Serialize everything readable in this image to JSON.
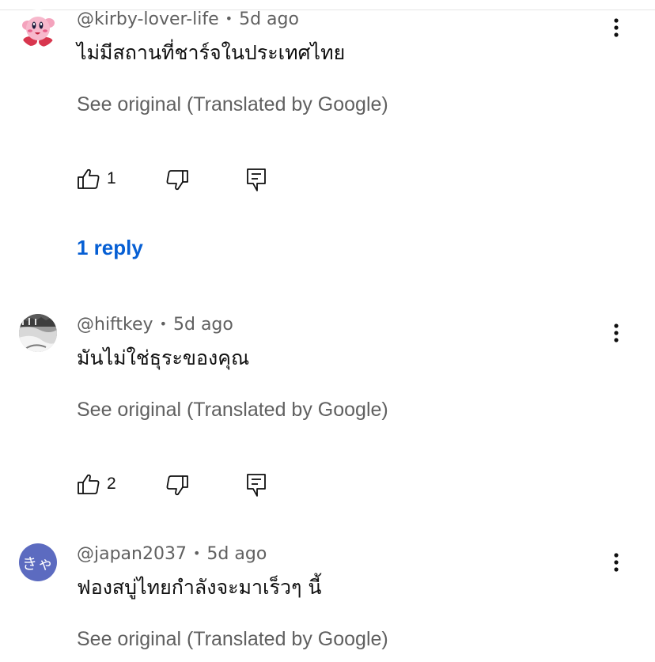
{
  "comments": [
    {
      "author": "@kirby-lover-life",
      "time": "5d ago",
      "text": "ไม่มีสถานที่ชาร์จในประเทศไทย",
      "see_original": "See original (Translated by Google)",
      "likes": "1",
      "replies_label": "1 reply",
      "avatar": "kirby-avatar"
    },
    {
      "author": "@hiftkey",
      "time": "5d ago",
      "text": "มันไม่ใช่ธุระของคุณ",
      "see_original": "See original (Translated by Google)",
      "likes": "2",
      "avatar": "photo-avatar"
    },
    {
      "author": "@japan2037",
      "time": "5d ago",
      "text": "ฟองสบู่ไทยกำลังจะมาเร็วๆ นี้",
      "see_original": "See original (Translated by Google)",
      "avatar": "initials-avatar",
      "avatar_initials": "きゃ"
    }
  ],
  "separator": "•",
  "colors": {
    "link": "#065fd4",
    "secondary_text": "#606060",
    "primary_text": "#0f0f0f",
    "initials_avatar_bg": "#5c6bc0"
  },
  "icons": [
    "thumbs-up-icon",
    "thumbs-down-icon",
    "reply-icon",
    "more-vert-icon"
  ]
}
